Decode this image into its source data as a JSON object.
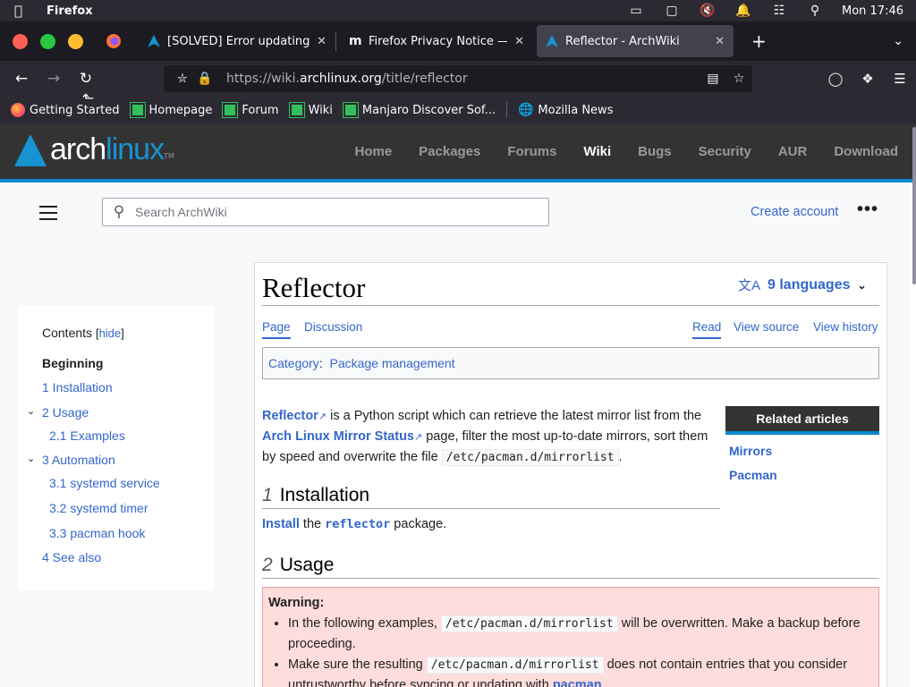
{
  "menubar": {
    "app_name": "Firefox",
    "clock": "Mon 17:46"
  },
  "tabs": [
    {
      "title": "[SOLVED] Error updating sy"
    },
    {
      "title": "Firefox Privacy Notice — M"
    },
    {
      "title": "Reflector - ArchWiki"
    }
  ],
  "urlbar": {
    "url_prefix": "https://wiki.",
    "url_domain": "archlinux.org",
    "url_path": "/title/reflector"
  },
  "bookmarks": [
    {
      "label": "Getting Started"
    },
    {
      "label": "Homepage"
    },
    {
      "label": "Forum"
    },
    {
      "label": "Wiki"
    },
    {
      "label": "Manjaro Discover Sof..."
    },
    {
      "label": "Mozilla News"
    }
  ],
  "arch": {
    "logo_arch": "arch",
    "logo_linux": "linux",
    "tm": "TM",
    "nav": [
      "Home",
      "Packages",
      "Forums",
      "Wiki",
      "Bugs",
      "Security",
      "AUR",
      "Download"
    ],
    "current_nav": "Wiki"
  },
  "wiki": {
    "search_placeholder": "Search ArchWiki",
    "create_account": "Create account",
    "more": "•••",
    "title": "Reflector",
    "languages": "9 languages",
    "tabs_left": [
      "Page",
      "Discussion"
    ],
    "tabs_right": [
      "Read",
      "View source",
      "View history"
    ],
    "category_label": "Category",
    "category_value": "Package management",
    "intro_link1": "Reflector",
    "intro_text1": " is a Python script which can retrieve the latest mirror list from the ",
    "intro_link2": "Arch Linux Mirror Status",
    "intro_text2": " page, filter the most up-to-date mirrors, sort them by speed and overwrite the file ",
    "intro_code": "/etc/pacman.d/mirrorlist",
    "intro_end": ".",
    "related_title": "Related articles",
    "related_items": [
      "Mirrors",
      "Pacman"
    ],
    "h_install_num": "1",
    "h_install": "Installation",
    "install_link": "Install",
    "install_text1": " the ",
    "install_pkg": "reflector",
    "install_text2": " package.",
    "h_usage_num": "2",
    "h_usage": "Usage",
    "warning_title": "Warning:",
    "warn1_a": "In the following examples, ",
    "warn1_code": "/etc/pacman.d/mirrorlist",
    "warn1_b": " will be overwritten. Make a backup before proceeding.",
    "warn2_a": "Make sure the resulting ",
    "warn2_code": "/etc/pacman.d/mirrorlist",
    "warn2_b": " does not contain entries that you consider untrustworthy before syncing or updating with ",
    "warn2_link": "pacman",
    "warn2_end": "."
  },
  "toc": {
    "title": "Contents",
    "hide_label": "hide",
    "entries": [
      {
        "label": "Beginning"
      },
      {
        "label": "1  Installation"
      },
      {
        "label": "2  Usage"
      },
      {
        "label": "2.1  Examples"
      },
      {
        "label": "3  Automation"
      },
      {
        "label": "3.1  systemd service"
      },
      {
        "label": "3.2  systemd timer"
      },
      {
        "label": "3.3  pacman hook"
      },
      {
        "label": "4  See also"
      }
    ]
  },
  "colors": {
    "arch_blue": "#1793d1",
    "link": "#3366cc",
    "header_bg": "#333333",
    "warning_bg": "#ffdddd"
  }
}
